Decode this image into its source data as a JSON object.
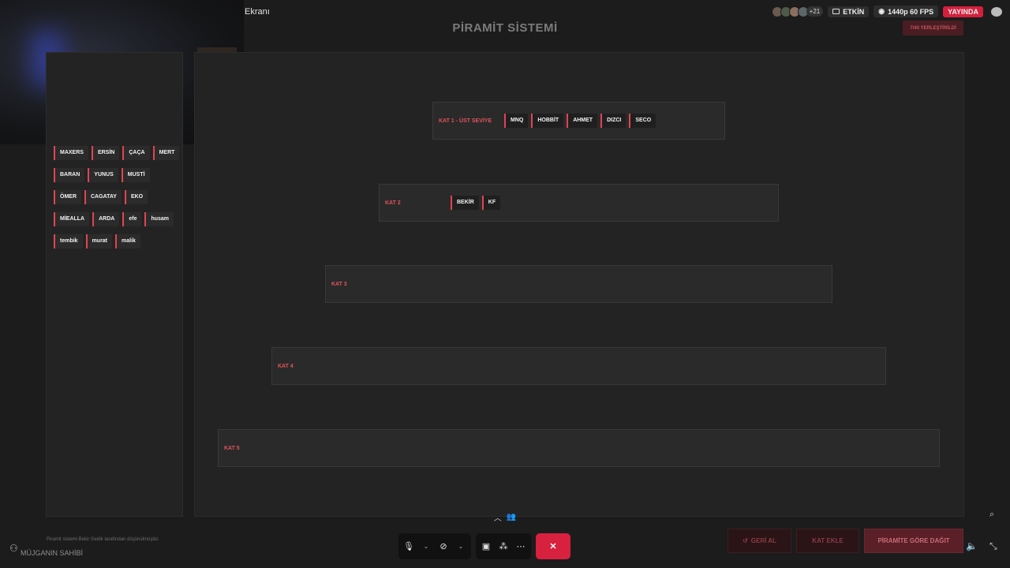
{
  "window": {
    "share_title": "Ekranı"
  },
  "top_bar": {
    "participants_extra": "+21",
    "activity_label": "ETKİN",
    "quality_label": "1440p 60 FPS",
    "live_label": "YAYINDA"
  },
  "page": {
    "title": "PİRAMİT SİSTEMİ",
    "placed_counter": "7/40 YERLEŞTİRİLDİ"
  },
  "pool": {
    "rows": [
      [
        "MAXERS",
        "ERSİN",
        "ÇAÇA",
        "MERT"
      ],
      [
        "BARAN",
        "YUNUS",
        "MUSTİ"
      ],
      [
        "ÖMER",
        "CAGATAY",
        "EKO"
      ],
      [
        "MİEALLA",
        "ARDA",
        "efe",
        "husam"
      ],
      [
        "tembik",
        "murat",
        "malik"
      ]
    ]
  },
  "tiers": [
    {
      "label": "KAT 1 - ÜST SEVİYE",
      "members": [
        "MNQ",
        "HOBBİT",
        "AHMET",
        "DIZCI",
        "SECO"
      ]
    },
    {
      "label": "KAT 2",
      "members": [
        "BEKİR",
        "KF"
      ]
    },
    {
      "label": "KAT 3",
      "members": []
    },
    {
      "label": "KAT 4",
      "members": []
    },
    {
      "label": "KAT 5",
      "members": []
    }
  ],
  "footer": {
    "credit": "Piramit sistemi Bekir Gedik tarafından düşünülmüştür.",
    "owner": "MÜJGANIN SAHİBİ"
  },
  "controls": {
    "undo_label": "GERİ AL",
    "add_tier_label": "KAT EKLE",
    "distribute_label": "PİRAMİTE GÖRE DAĞIT"
  },
  "colors": {
    "accent": "#e04452",
    "live": "#d51f3c",
    "end_share": "#d8203f"
  }
}
